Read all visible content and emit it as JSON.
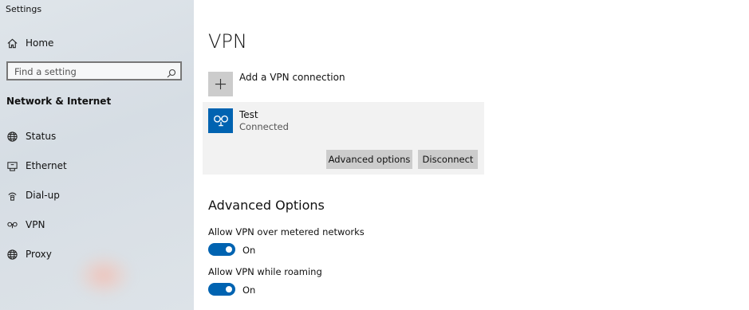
{
  "app": {
    "title": "Settings"
  },
  "sidebar": {
    "home_label": "Home",
    "search_placeholder": "Find a setting",
    "section_title": "Network & Internet",
    "items": [
      {
        "label": "Status",
        "icon": "globe-icon"
      },
      {
        "label": "Ethernet",
        "icon": "ethernet-icon"
      },
      {
        "label": "Dial-up",
        "icon": "dialup-icon"
      },
      {
        "label": "VPN",
        "icon": "vpn-icon"
      },
      {
        "label": "Proxy",
        "icon": "globe-icon"
      }
    ]
  },
  "main": {
    "title": "VPN",
    "add_connection_label": "Add a VPN connection",
    "connection": {
      "name": "Test",
      "status": "Connected",
      "advanced_options_label": "Advanced options",
      "disconnect_label": "Disconnect"
    },
    "advanced": {
      "heading": "Advanced Options",
      "options": [
        {
          "label": "Allow VPN over metered networks",
          "state": "On",
          "on": true
        },
        {
          "label": "Allow VPN while roaming",
          "state": "On",
          "on": true
        }
      ]
    }
  },
  "colors": {
    "accent": "#0063b1",
    "sidebar_bg": "#dce3e8",
    "button_bg": "#cccccc",
    "card_bg": "#f2f2f2"
  }
}
